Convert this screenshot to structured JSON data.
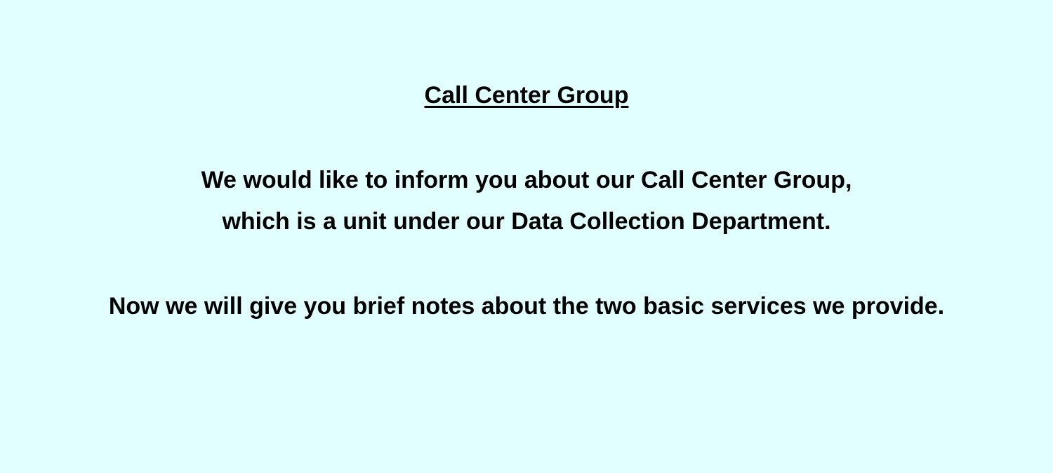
{
  "slide": {
    "title": "Call Center Group",
    "intro_line1": "We would like to inform you about our Call Center Group,",
    "intro_line2": "which is a unit under our Data Collection Department.",
    "services_note": "Now we will give you brief notes about the two basic services we provide."
  },
  "colors": {
    "background": "#e1ffff",
    "text": "#000000"
  }
}
